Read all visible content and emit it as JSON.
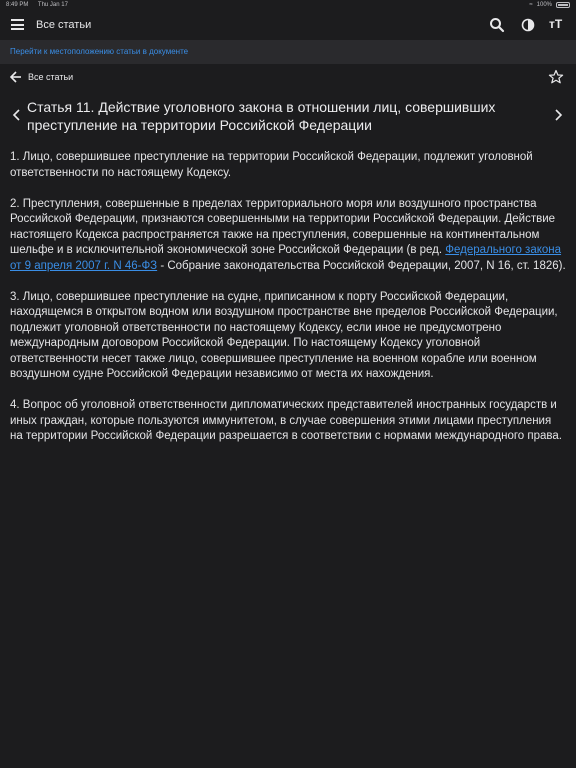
{
  "status": {
    "time": "8:49 PM",
    "date": "Thu Jan 17",
    "battery": "100%"
  },
  "toolbar": {
    "title": "Все статьи",
    "text_size_label": "тТ"
  },
  "locator": {
    "link": "Перейти к местоположению статьи в документе"
  },
  "nav": {
    "back_label": "Все статьи"
  },
  "article": {
    "title": "Статья 11. Действие уголовного закона в отношении лиц, совершивших преступление на территории Российской Федерации",
    "p1": "1. Лицо, совершившее преступление на территории Российской Федерации, подлежит уголовной ответственности по настоящему Кодексу.",
    "p2_before": "2. Преступления, совершенные в пределах территориального моря или воздушного пространства Российской Федерации, признаются совершенными на территории Российской Федерации. Действие настоящего Кодекса распространяется также на преступления, совершенные на континентальном шельфе и в исключительной экономической зоне Российской Федерации (в ред. ",
    "p2_link": "Федерального закона от 9 апреля 2007 г. N 46-ФЗ",
    "p2_after": " - Собрание законодательства Российской Федерации, 2007, N 16, ст. 1826).",
    "p3": "3. Лицо, совершившее преступление на судне, приписанном к порту Российской Федерации, находящемся в открытом водном или воздушном пространстве вне пределов Российской Федерации, подлежит уголовной ответственности по настоящему Кодексу, если иное не предусмотрено международным договором Российской Федерации. По настоящему Кодексу уголовной ответственности несет также лицо, совершившее преступление на военном корабле или военном воздушном судне Российской Федерации независимо от места их нахождения.",
    "p4": "4. Вопрос об уголовной ответственности дипломатических представителей иностранных государств и иных граждан, которые пользуются иммунитетом, в случае совершения этими лицами преступления на территории Российской Федерации разрешается в соответствии с нормами международного права."
  },
  "colors": {
    "background": "#1c1c1e",
    "link": "#3a8ee6",
    "text": "#e4e4e6"
  }
}
